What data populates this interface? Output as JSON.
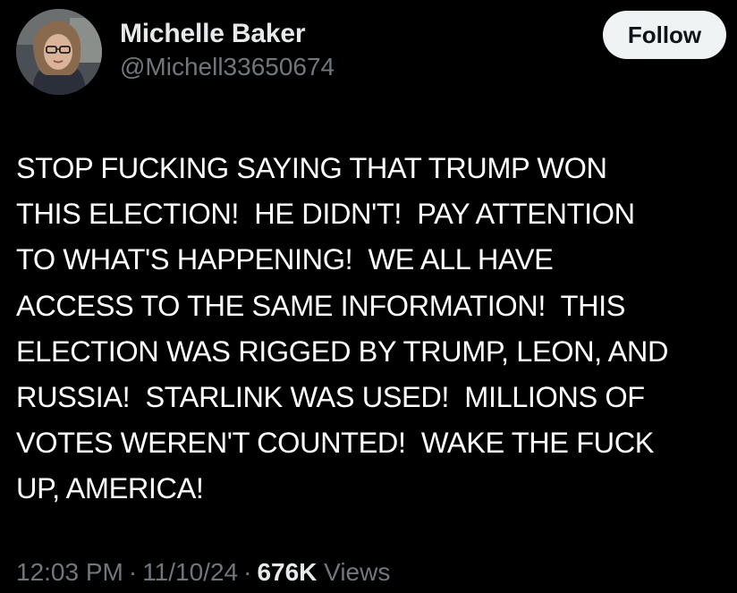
{
  "author": {
    "display_name": "Michelle Baker",
    "handle": "@Michell33650674"
  },
  "follow_button": {
    "label": "Follow"
  },
  "tweet": {
    "text": "STOP FUCKING SAYING THAT TRUMP WON\nTHIS ELECTION!  HE DIDN'T!  PAY ATTENTION\nTO WHAT'S HAPPENING!  WE ALL HAVE\nACCESS TO THE SAME INFORMATION!  THIS\nELECTION WAS RIGGED BY TRUMP, LEON, AND\nRUSSIA!  STARLINK WAS USED!  MILLIONS OF\nVOTES WEREN'T COUNTED!  WAKE THE FUCK\nUP, AMERICA!"
  },
  "meta": {
    "time": "12:03 PM",
    "separator": "·",
    "date": "11/10/24",
    "views_count": "676K",
    "views_label": "Views"
  },
  "colors": {
    "background": "#000000",
    "text_primary": "#e7e9ea",
    "text_secondary": "#71767b",
    "button_bg": "#eff3f4",
    "button_text": "#0f1419"
  }
}
